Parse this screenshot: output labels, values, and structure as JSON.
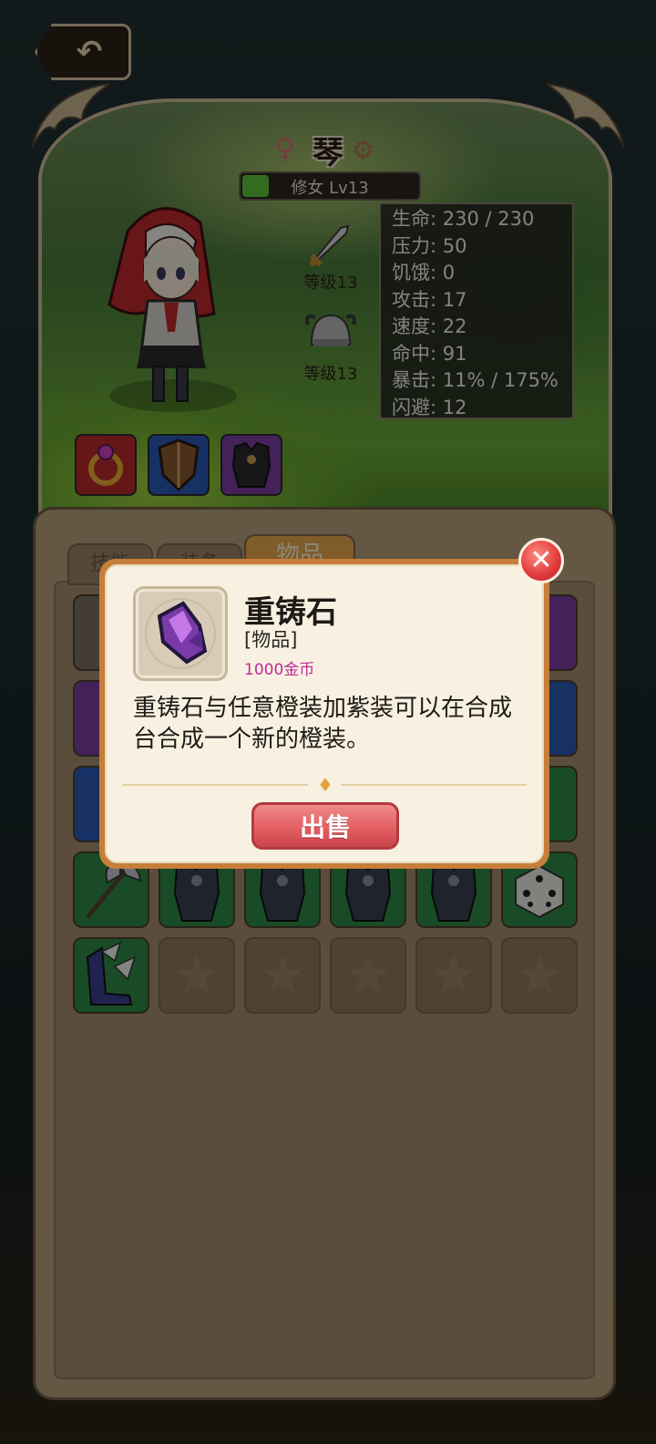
{
  "hero": {
    "name": "琴",
    "level_text": "修女 Lv13",
    "level_progress": 0.15,
    "weapon_level": "等级13",
    "armor_level": "等级13"
  },
  "stats": [
    "生命: 230 / 230",
    "压力: 50",
    "饥饿: 0",
    "攻击: 17",
    "速度: 22",
    "命中: 91",
    "暴击: 11% / 175%",
    "闪避: 12"
  ],
  "tabs": [
    "技能",
    "装备",
    "物品"
  ],
  "active_tab": 2,
  "popup": {
    "item_name": "重铸石",
    "item_type": "[物品]",
    "item_price": "1000金币",
    "item_desc": "重铸石与任意橙装加紫装可以在合成台合成一个新的橙装。",
    "sell_label": "出售"
  },
  "icons": {
    "back": "back-arrow-icon",
    "close": "close-icon",
    "gender": "female-icon",
    "settings": "gear-icon"
  },
  "colors": {
    "accent_orange": "#c77e3a",
    "price_magenta": "#c02a9a",
    "sell_red": "#e35f62",
    "level_green": "#5cc63a"
  }
}
